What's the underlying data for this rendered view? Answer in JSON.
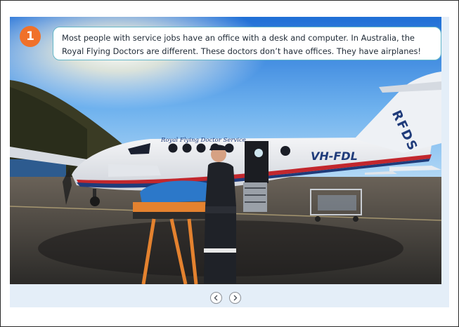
{
  "slide": {
    "step_number": "1",
    "caption_line1": "Most people with service jobs have an office with a desk and computer. In Australia, the",
    "caption_line2": "Royal Flying Doctors are different. These doctors don’t have offices. They have airplanes!"
  },
  "photo": {
    "fuselage_text": "Royal Flying Doctor Service",
    "registration": "VH-FDL",
    "tail_text": "RFDS",
    "badge_color": "#f0712a",
    "caption_border_color": "#63b7c8"
  },
  "navigation": {
    "previous_icon": "chevron-left-icon",
    "next_icon": "chevron-right-icon"
  }
}
